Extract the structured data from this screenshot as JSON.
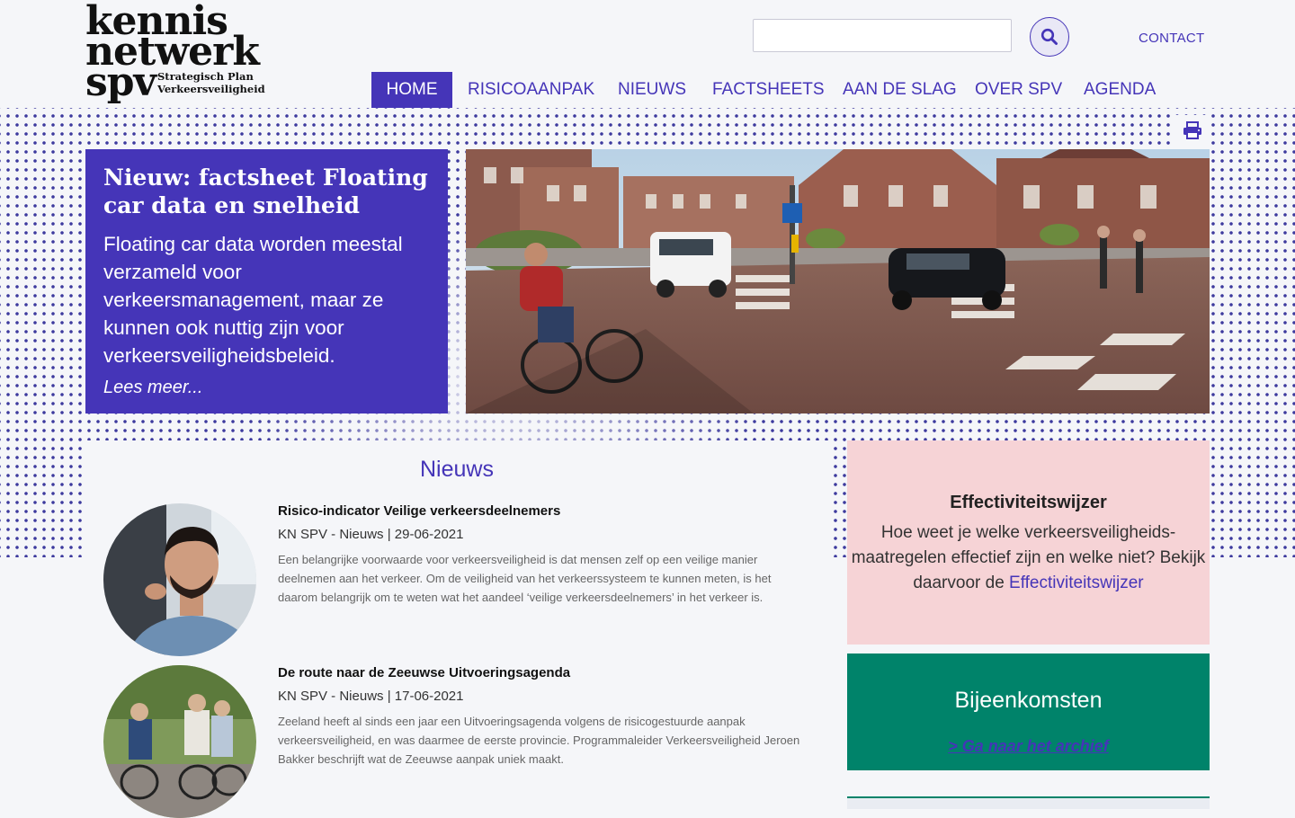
{
  "logo": {
    "line1": "kennis",
    "line2": "netwerk",
    "line3": "spv",
    "tagline1": "Strategisch Plan",
    "tagline2": "Verkeersveiligheid"
  },
  "search": {
    "placeholder": "",
    "value": "",
    "button_icon": "search-icon"
  },
  "contact_label": "CONTACT",
  "nav": {
    "items": [
      {
        "label": "HOME",
        "active": true
      },
      {
        "label": "RISICOAANPAK"
      },
      {
        "label": "NIEUWS"
      },
      {
        "label": "FACTSHEETS"
      },
      {
        "label": "AAN DE SLAG"
      },
      {
        "label": "OVER SPV"
      },
      {
        "label": "AGENDA"
      }
    ]
  },
  "print_icon": "print-icon",
  "feature": {
    "title": "Nieuw: factsheet Floating car data en snelheid",
    "text": "Floating car data worden meestal verzameld voor verkeersmanagement, maar ze kunnen ook nuttig zijn voor verkeersveiligheidsbeleid.",
    "more": "Lees meer..."
  },
  "news": {
    "title": "Nieuws",
    "items": [
      {
        "title": "Risico-indicator Veilige verkeersdeelnemers",
        "meta": "KN SPV - Nieuws | 29-06-2021",
        "text": "Een belangrijke voorwaarde voor verkeersveiligheid is dat mensen zelf op een veilige manier deelnemen aan het verkeer. Om de veiligheid van het verkeerssysteem te kunnen meten, is het daarom belangrijk om te weten wat het aandeel ‘veilige verkeersdeelnemers’ in het verkeer is."
      },
      {
        "title": "De route naar de Zeeuwse Uitvoeringsagenda",
        "meta": "KN SPV - Nieuws | 17-06-2021",
        "text": "Zeeland heeft al sinds een jaar een Uitvoeringsagenda volgens de risicogestuurde aanpak verkeersveiligheid, en was daarmee de eerste provincie. Programmaleider Verkeersveiligheid Jeroen Bakker beschrijft wat de Zeeuwse aanpak uniek maakt."
      }
    ]
  },
  "effectiviteit": {
    "title": "Effectiviteitswijzer",
    "text": "Hoe weet je welke verkeersveiligheids-maatregelen effectief zijn en welke niet? Bekijk daarvoor de",
    "link": "Effectiviteitswijzer"
  },
  "bijeenkomsten": {
    "title": "Bijeenkomsten",
    "link": "> Ga naar het archief"
  },
  "colors": {
    "brand": "#4535b8",
    "pink": "#f6d3d6",
    "green": "#00836a"
  }
}
